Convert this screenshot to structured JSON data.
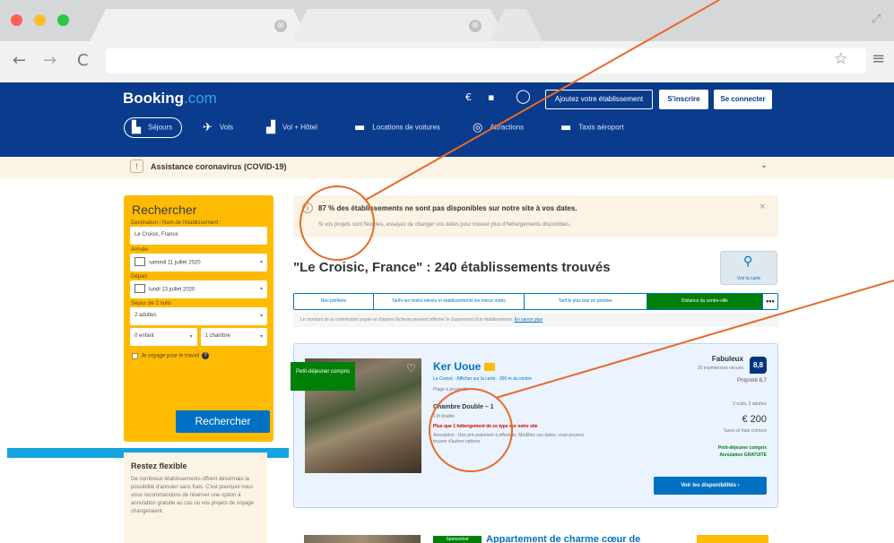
{
  "browser": {
    "tabs": [
      {
        "close": "⊗"
      },
      {
        "close": "⊗"
      }
    ],
    "nav": {
      "back": "←",
      "forward": "→",
      "reload": "C",
      "star": "☆",
      "menu": "≡",
      "expand": "⤢"
    }
  },
  "header": {
    "logo_main": "Booking",
    "logo_suffix": ".com",
    "register_property": "Ajoutez votre établissement",
    "register": "S'inscrire",
    "sign_in": "Se connecter",
    "nav": [
      {
        "icon": "bed-icon",
        "glyph": "▙",
        "label": "Séjours"
      },
      {
        "icon": "plane-icon",
        "glyph": "✈",
        "label": "Vols"
      },
      {
        "icon": "flight-hotel-icon",
        "glyph": "▟",
        "label": "Vol + Hôtel"
      },
      {
        "icon": "car-icon",
        "glyph": "▬",
        "label": "Locations de voitures"
      },
      {
        "icon": "attractions-icon",
        "glyph": "◎",
        "label": "Attractions"
      },
      {
        "icon": "taxi-icon",
        "glyph": "▬",
        "label": "Taxis aéroport"
      }
    ]
  },
  "covid": {
    "text": "Assistance coronavirus (COVID-19)",
    "chevron": "⌄"
  },
  "search": {
    "title": "Rechercher",
    "destination_label": "Destination / Nom de l'établissement :",
    "destination_value": "Le Croisic, France",
    "checkin_label": "Arrivée",
    "checkin_value": "samedi 11 juillet 2020",
    "checkout_label": "Départ",
    "checkout_value": "lundi 13 juillet 2020",
    "duration_label": "Séjour de 2 nuits",
    "adults_value": "2 adultes",
    "children_value": "0 enfant",
    "rooms_value": "1 chambre",
    "caret": "▾",
    "work_trip": "Je voyage pour le travail",
    "help": "?",
    "submit": "Rechercher"
  },
  "flex": {
    "title": "Restez flexible",
    "text": "De nombreux établissements offrent désormais la possibilité d'annuler sans frais. C'est pourquoi nous vous recommandons de réserver une option à annulation gratuite au cas où vos projets de voyage changeraient."
  },
  "alert": {
    "icon": "i",
    "title": "87 % des établissements ne sont pas disponibles sur notre site à vos dates.",
    "subtitle": "Si vos projets sont flexibles, essayez de changer vos dates pour trouver plus d'hébergements disponibles.",
    "close": "×"
  },
  "results_title": "\"Le Croisic, France\" : 240 établissements trouvés",
  "map": {
    "pin": "⚲",
    "label": "Voir la carte"
  },
  "sort_tabs": [
    {
      "label": "Nos préférés",
      "active": false
    },
    {
      "label": "Tarifs les moins élevés et établissements les mieux notés",
      "active": false
    },
    {
      "label": "Tarif le plus bas en premier",
      "active": false
    },
    {
      "label": "Distance du centre-ville",
      "active": true
    },
    {
      "label": "•••",
      "active": false
    }
  ],
  "ranking_note": "Le montant de la commission payée et d'autres facteurs peuvent affecter le classement d'un établissement.",
  "ranking_link": "En savoir plus",
  "card": {
    "badge": "Petit-déjeuner compris",
    "name": "Ker Uoue",
    "location": "Le Croisic · Afficher sur la carte · 300 m du centre",
    "distance": "Plage à proximité",
    "room": "Chambre Double – 1",
    "room_sub": "1 lit double",
    "urgent": "Plus que 1 hébergement de ce type sur notre site",
    "cancel": "Annulation : Une pré-paiement à effectuer. Modifiez vos dates, vous pourrez trouver d'autres options.",
    "score_word": "Fabuleux",
    "score_count": "20 expériences vécues",
    "score": "8,8",
    "score_extra": "Propreté 8,7",
    "price_nights": "2 nuits, 2 adultes",
    "price": "€ 200",
    "price_tax": "Taxes et frais compris",
    "free_cancel_1": "Petit-déjeuner compris",
    "free_cancel_2": "Annulation GRATUITE",
    "cta": "Voir les disponibilités  ›",
    "fav": "♡"
  },
  "card2": {
    "badge": "Sponsorisé",
    "title": "Appartement de charme cœur de"
  },
  "colors": {
    "brand_blue": "#0a3b8c",
    "cta_blue": "#0071c2",
    "search_yellow": "#febb02",
    "green": "#008009",
    "annotation": "#e8692a"
  }
}
